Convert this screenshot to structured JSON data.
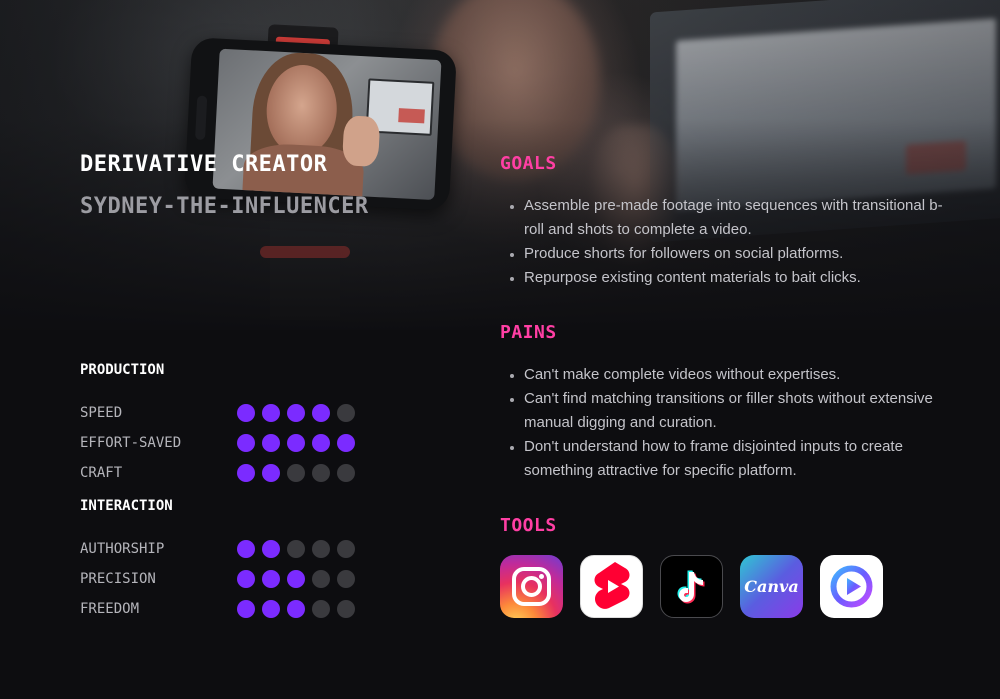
{
  "persona": {
    "title": "DERIVATIVE CREATOR",
    "subtitle": "SYDNEY-THE-INFLUENCER"
  },
  "ratings": {
    "groups": [
      {
        "heading": "PRODUCTION",
        "items": [
          {
            "label": "SPEED",
            "value": 4,
            "max": 5
          },
          {
            "label": "EFFORT-SAVED",
            "value": 5,
            "max": 5
          },
          {
            "label": "CRAFT",
            "value": 2,
            "max": 5
          }
        ]
      },
      {
        "heading": "INTERACTION",
        "items": [
          {
            "label": "AUTHORSHIP",
            "value": 2,
            "max": 5
          },
          {
            "label": "PRECISION",
            "value": 3,
            "max": 5
          },
          {
            "label": "FREEDOM",
            "value": 3,
            "max": 5
          }
        ]
      }
    ]
  },
  "goals": {
    "heading": "GOALS",
    "items": [
      "Assemble pre-made footage into sequences with transitional b-roll and shots to complete a video.",
      "Produce shorts for followers on social platforms.",
      "Repurpose existing content materials to bait clicks."
    ]
  },
  "pains": {
    "heading": "PAINS",
    "items": [
      "Can't make complete videos without expertises.",
      "Can't find matching transitions or filler shots without extensive manual digging and curation.",
      "Don't understand how to frame disjointed inputs to create something attractive for specific platform."
    ]
  },
  "tools": {
    "heading": "TOOLS",
    "items": [
      {
        "icon": "instagram-icon"
      },
      {
        "icon": "youtube-shorts-icon"
      },
      {
        "icon": "tiktok-icon"
      },
      {
        "icon": "canva-icon",
        "label": "Canva"
      },
      {
        "icon": "clipchamp-icon"
      }
    ]
  },
  "colors": {
    "accent_heading": "#ff3fa4",
    "dot_on": "#7b2bff",
    "dot_off": "#3a3a3e",
    "background": "#0d0d10"
  }
}
